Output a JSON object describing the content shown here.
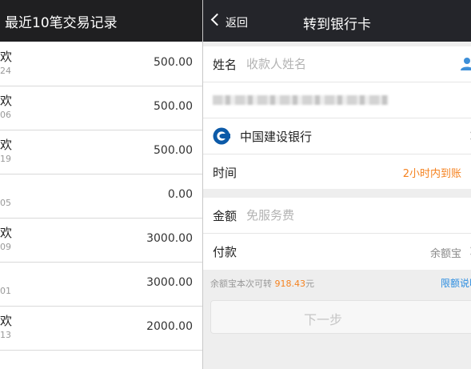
{
  "left_panel": {
    "title": "最近10笔交易记录",
    "records": [
      {
        "title": "欢",
        "sub": "24",
        "amount": "500.00"
      },
      {
        "title": "欢",
        "sub": "06",
        "amount": "500.00"
      },
      {
        "title": "欢",
        "sub": "19",
        "amount": "500.00"
      },
      {
        "title": "",
        "sub": "05",
        "amount": "0.00"
      },
      {
        "title": "欢",
        "sub": "09",
        "amount": "3000.00"
      },
      {
        "title": "",
        "sub": "01",
        "amount": "3000.00"
      },
      {
        "title": "欢",
        "sub": "13",
        "amount": "2000.00"
      }
    ]
  },
  "header": {
    "back_label": "返回",
    "title": "转到银行卡"
  },
  "form": {
    "name_label": "姓名",
    "name_placeholder": "收款人姓名",
    "bank_name": "中国建设银行",
    "time_label": "时间",
    "time_value": "2小时内到账",
    "amount_label": "金额",
    "amount_placeholder": "免服务费",
    "pay_label": "付款",
    "pay_value": "余额宝"
  },
  "note": {
    "text_prefix": "余额宝本次可转 ",
    "amount": "918.43",
    "unit": "元",
    "limit_link": "限额说明"
  },
  "next_button": "下一步",
  "colors": {
    "accent_orange": "#f5821f",
    "link_blue": "#2a8ce0",
    "header_bg": "#24252a",
    "bank_blue": "#0c5aa8"
  },
  "icons": {
    "back": "chevron-left-icon",
    "contact": "person-icon",
    "bank": "ccb-bank-logo-icon"
  }
}
